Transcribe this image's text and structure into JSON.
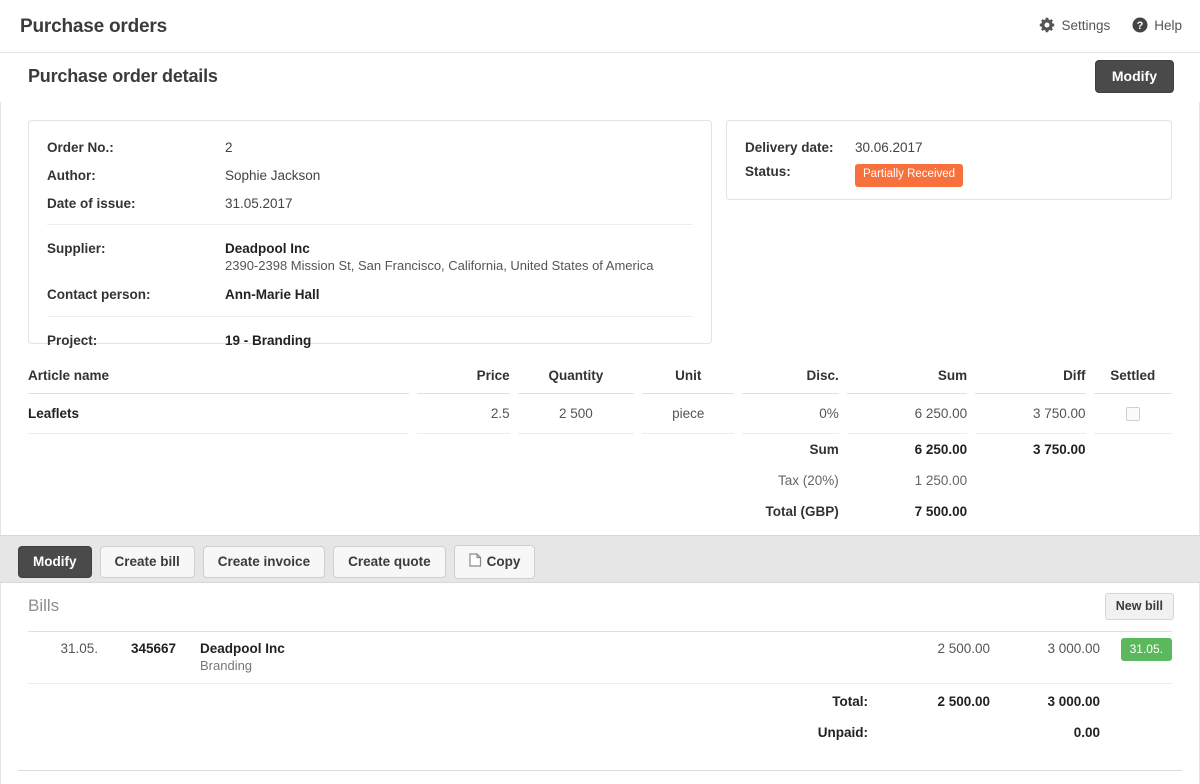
{
  "appbar": {
    "title": "Purchase orders",
    "settings_label": "Settings",
    "help_label": "Help",
    "settings_icon": "gear-icon",
    "help_icon": "question-circle-icon"
  },
  "section": {
    "title": "Purchase order details",
    "modify_label": "Modify"
  },
  "details": {
    "order_no_label": "Order No.:",
    "order_no_value": "2",
    "author_label": "Author:",
    "author_value": "Sophie Jackson",
    "date_of_issue_label": "Date of issue:",
    "date_of_issue_value": "31.05.2017",
    "supplier_label": "Supplier:",
    "supplier_name": "Deadpool Inc",
    "supplier_address": "2390-2398 Mission St, San Francisco, California, United States of America",
    "contact_person_label": "Contact person:",
    "contact_person_value": "Ann-Marie Hall",
    "project_label": "Project:",
    "project_value": "19 - Branding"
  },
  "delivery": {
    "delivery_date_label": "Delivery date:",
    "delivery_date_value": "30.06.2017",
    "status_label": "Status:",
    "status_value": "Partially Received",
    "status_color": "#f8703c"
  },
  "items": {
    "columns": [
      "Article name",
      "Price",
      "Quantity",
      "Unit",
      "Disc.",
      "Sum",
      "Diff",
      "Settled"
    ],
    "rows": [
      {
        "article": "Leaflets",
        "price": "2.5",
        "quantity": "2 500",
        "unit": "piece",
        "disc": "0%",
        "sum": "6 250.00",
        "diff": "3 750.00",
        "settled": false
      }
    ],
    "totals": {
      "sum_label": "Sum",
      "sum_value": "6 250.00",
      "sum_diff": "3 750.00",
      "tax_label": "Tax (20%)",
      "tax_value": "1 250.00",
      "total_label": "Total (GBP)",
      "total_value": "7 500.00"
    }
  },
  "toolbar": {
    "modify_label": "Modify",
    "create_bill_label": "Create bill",
    "create_invoice_label": "Create invoice",
    "create_quote_label": "Create quote",
    "copy_label": "Copy",
    "copy_icon": "copy-icon"
  },
  "bills": {
    "title": "Bills",
    "new_bill_label": "New bill",
    "rows": [
      {
        "date": "31.05.",
        "number": "345667",
        "party": "Deadpool Inc",
        "project": "Branding",
        "amount1": "2 500.00",
        "amount2": "3 000.00",
        "badge": "31.05.",
        "badge_color": "#5cb85c"
      }
    ],
    "totals": {
      "total_label": "Total:",
      "total_amount1": "2 500.00",
      "total_amount2": "3 000.00",
      "unpaid_label": "Unpaid:",
      "unpaid_value": "0.00"
    }
  }
}
